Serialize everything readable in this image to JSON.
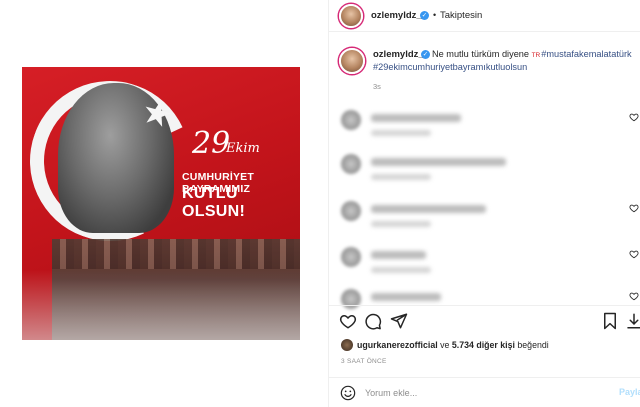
{
  "header": {
    "username": "ozlemyldz_",
    "separator": "•",
    "follow_label": "Takiptesin"
  },
  "caption": {
    "username": "ozlemyldz_",
    "text_prefix": "Ne mutlu türküm diyene ",
    "flag": "TR",
    "tag1": "#mustafakemalatatürk",
    "tag2": "#29ekimcumhuriyetbayramıkutluolsun",
    "time": "3s"
  },
  "image": {
    "badge_number": "29",
    "badge_script": "Ekim",
    "line1": "CUMHURİYET BAYRAMIMIZ",
    "line2": "KUTLU OLSUN!"
  },
  "likes": {
    "liker": "ugurkanerezofficial",
    "mid": " ve ",
    "count": "5.734 diğer kişi",
    "suffix": " beğendi"
  },
  "time_ago": "3 SAAT ÖNCE",
  "comment_box": {
    "placeholder": "Yorum ekle...",
    "post_label": "Paylaş"
  },
  "icons": {
    "like": "heart-icon",
    "comment": "comment-icon",
    "share": "paper-plane-icon",
    "save": "bookmark-icon",
    "emoji": "smiley-icon"
  },
  "colors": {
    "accent": "#3897f0",
    "link": "#385185",
    "post_disabled": "#b2dffc",
    "flag_red": "#d61f26"
  }
}
